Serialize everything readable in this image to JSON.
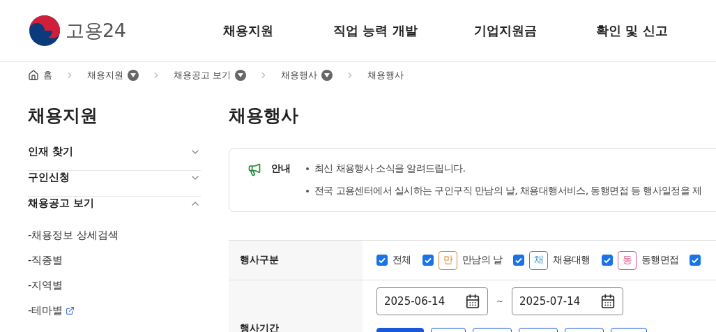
{
  "header": {
    "logo_text": "고용24",
    "nav": [
      {
        "label": "채용지원"
      },
      {
        "label": "직업 능력 개발"
      },
      {
        "label": "기업지원금"
      },
      {
        "label": "확인 및 신고"
      }
    ]
  },
  "breadcrumb": [
    {
      "label": "홈",
      "kind": "home"
    },
    {
      "label": "채용지원",
      "kind": "menu"
    },
    {
      "label": "채용공고 보기",
      "kind": "menu"
    },
    {
      "label": "채용행사",
      "kind": "menu"
    },
    {
      "label": "채용행사",
      "kind": "current"
    }
  ],
  "sidebar": {
    "title": "채용지원",
    "items": [
      {
        "label": "인재 찾기",
        "expanded": false
      },
      {
        "label": "구인신청",
        "expanded": false
      },
      {
        "label": "채용공고 보기",
        "expanded": true,
        "children": [
          {
            "label": "-채용정보 상세검색",
            "external": false
          },
          {
            "label": "-직종별",
            "external": false
          },
          {
            "label": "-지역별",
            "external": false
          },
          {
            "label": "-테마별",
            "external": true
          }
        ]
      }
    ]
  },
  "page_title": "채용행사",
  "notice": {
    "label": "안내",
    "lines": [
      "최신 채용행사 소식을 알려드립니다.",
      "전국 고용센터에서 실시하는 구인구직 만남의 날, 채용대행서비스, 동행면접 등 행사일정을 제"
    ]
  },
  "form": {
    "event_types": {
      "label": "행사구분",
      "options": [
        {
          "label": "전체",
          "checked": true
        },
        {
          "label": "만남의 날",
          "badge": "만",
          "color": "#d4882a",
          "checked": true
        },
        {
          "label": "채용대행",
          "badge": "채",
          "color": "#2f8fd6",
          "checked": true
        },
        {
          "label": "동행면접",
          "badge": "동",
          "color": "#e0508a",
          "checked": true
        },
        {
          "checked": true
        }
      ]
    },
    "period": {
      "label": "행사기간",
      "start": "2025-06-14",
      "separator": "~",
      "end": "2025-07-14",
      "buttons": [
        {
          "selected": true
        },
        {
          "selected": false
        },
        {
          "selected": false
        },
        {
          "selected": false
        },
        {
          "selected": false
        },
        {
          "selected": false
        }
      ]
    }
  }
}
